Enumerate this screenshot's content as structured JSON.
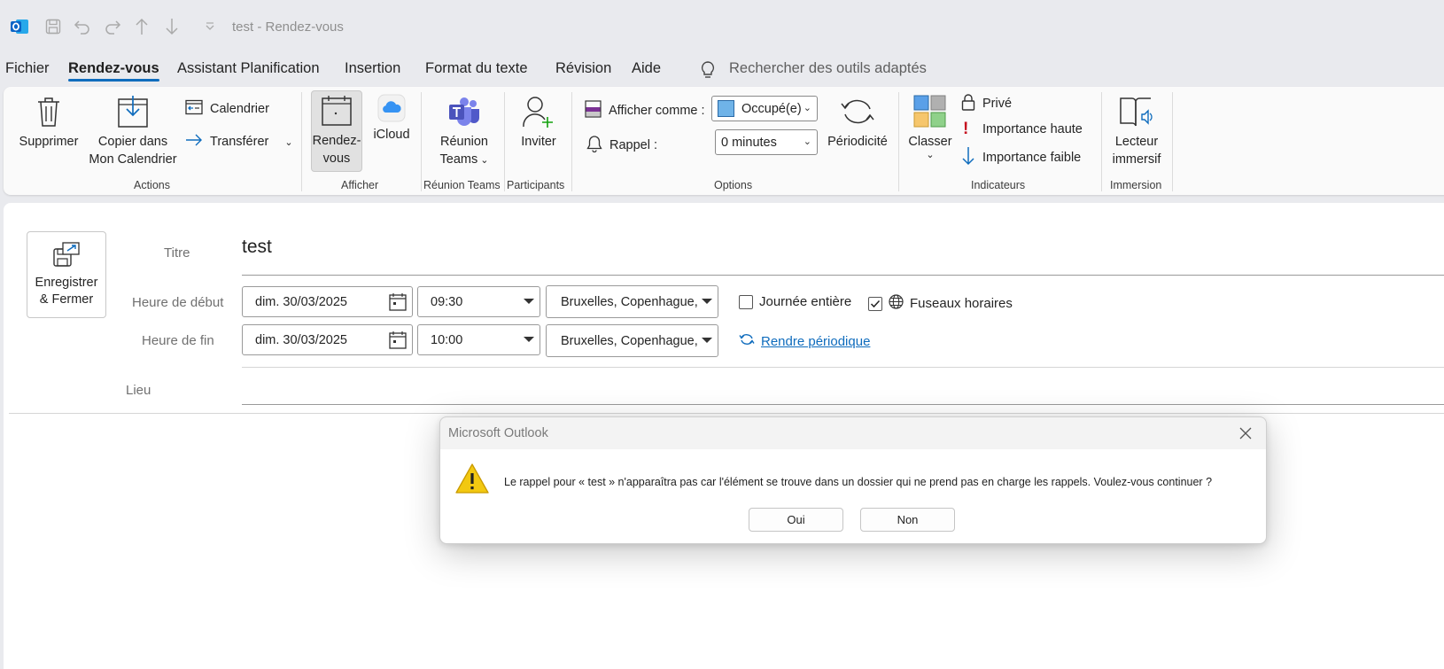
{
  "window": {
    "title": "test  -  Rendez-vous"
  },
  "menu": {
    "tabs": [
      "Fichier",
      "Rendez-vous",
      "Assistant Planification",
      "Insertion",
      "Format du texte",
      "Révision",
      "Aide"
    ],
    "active_tab": "Rendez-vous",
    "search_placeholder": "Rechercher des outils adaptés"
  },
  "ribbon": {
    "actions": {
      "delete": "Supprimer",
      "copy_line1": "Copier dans",
      "copy_line2": "Mon Calendrier",
      "calendar": "Calendrier",
      "forward": "Transférer",
      "label": "Actions"
    },
    "show": {
      "appointment_line1": "Rendez-",
      "appointment_line2": "vous",
      "icloud": "iCloud",
      "label": "Afficher"
    },
    "teams": {
      "line1": "Réunion",
      "line2": "Teams",
      "label": "Réunion Teams"
    },
    "participants": {
      "invite": "Inviter",
      "label": "Participants"
    },
    "options": {
      "show_as_label": "Afficher comme :",
      "show_as_value": "Occupé(e)",
      "reminder_label": "Rappel :",
      "reminder_value": "0 minutes",
      "recurrence": "Périodicité",
      "label": "Options"
    },
    "tags": {
      "categorize": "Classer",
      "private": "Privé",
      "high_importance": "Importance haute",
      "low_importance": "Importance faible",
      "label": "Indicateurs"
    },
    "immersive": {
      "line1": "Lecteur",
      "line2": "immersif",
      "label": "Immersion"
    }
  },
  "form": {
    "save_close_line1": "Enregistrer",
    "save_close_line2": "& Fermer",
    "title_label": "Titre",
    "title_value": "test",
    "start_label": "Heure de début",
    "start_date": "dim. 30/03/2025",
    "start_time": "09:30",
    "start_tz": "Bruxelles, Copenhague,",
    "end_label": "Heure de fin",
    "end_date": "dim. 30/03/2025",
    "end_time": "10:00",
    "end_tz": "Bruxelles, Copenhague,",
    "all_day": "Journée entière",
    "all_day_checked": false,
    "time_zones": "Fuseaux horaires",
    "time_zones_checked": true,
    "make_recurring": "Rendre périodique",
    "location_label": "Lieu",
    "location_value": ""
  },
  "dialog": {
    "title": "Microsoft Outlook",
    "message": "Le rappel pour « test » n'apparaîtra pas car l'élément se trouve dans un dossier qui ne prend pas en charge les rappels. Voulez-vous continuer ?",
    "yes": "Oui",
    "no": "Non"
  },
  "colors": {
    "accent": "#0f6cbd",
    "busy_swatch": "#6fb3e8",
    "outlook_blue": "#0a64c6",
    "warning": "#f2c811",
    "importance_red": "#c50f1f"
  }
}
